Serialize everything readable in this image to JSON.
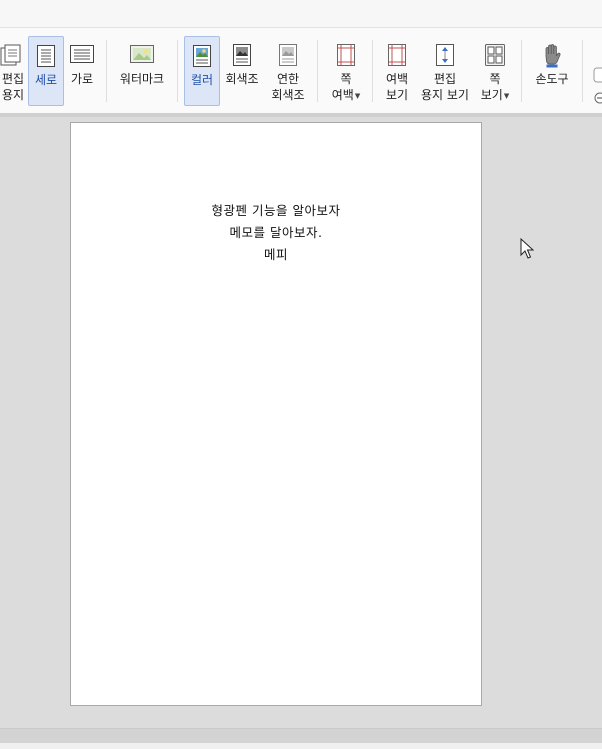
{
  "ribbon": {
    "buttons": [
      {
        "id": "edit-paper",
        "line1": "편집",
        "line2": "용지",
        "icon": "edit-paper-icon"
      },
      {
        "id": "portrait",
        "line1": "세로",
        "icon": "portrait-page-icon"
      },
      {
        "id": "landscape",
        "line1": "가로",
        "icon": "landscape-page-icon"
      },
      {
        "id": "watermark",
        "line1": "워터마크",
        "icon": "watermark-icon"
      },
      {
        "id": "color",
        "line1": "컬러",
        "icon": "color-mode-icon"
      },
      {
        "id": "grayscale",
        "line1": "회색조",
        "icon": "grayscale-icon"
      },
      {
        "id": "light-grayscale",
        "line1": "연한",
        "line2": "회색조",
        "icon": "light-grayscale-icon"
      },
      {
        "id": "page-margin",
        "line1": "쪽",
        "line2": "여백",
        "icon": "page-margin-icon"
      },
      {
        "id": "margin-view",
        "line1": "여백",
        "line2": "보기",
        "icon": "margin-view-icon"
      },
      {
        "id": "edit-paper-view",
        "line1": "편집",
        "line2": "용지 보기",
        "icon": "edit-paper-view-icon"
      },
      {
        "id": "page-view",
        "line1": "쪽",
        "line2": "보기",
        "icon": "multi-page-view-icon"
      },
      {
        "id": "hand-tool",
        "line1": "손도구",
        "icon": "hand-tool-icon"
      }
    ]
  },
  "document": {
    "lines": [
      "형광펜 기능을 알아보자",
      "메모를 달아보자.",
      "메피"
    ]
  },
  "colors": {
    "active_bg": "#dde6f7",
    "active_border": "#a9bfe6",
    "margin_red": "#c0504d",
    "page_bg": "#ffffff",
    "workspace_bg": "#dcdcdc"
  }
}
